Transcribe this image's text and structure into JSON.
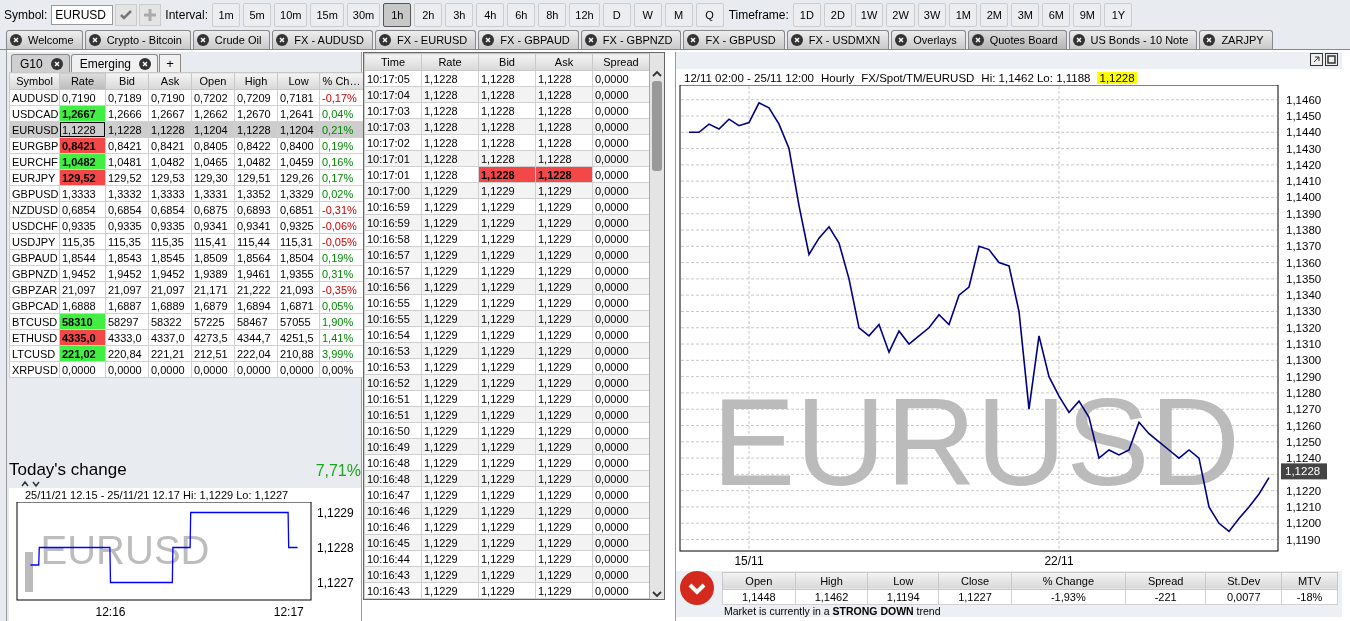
{
  "toolbar": {
    "symbol_label": "Symbol:",
    "symbol": "EURUSD",
    "interval_label": "Interval:",
    "intervals": [
      {
        "label": "1m",
        "selected": false
      },
      {
        "label": "5m",
        "selected": false
      },
      {
        "label": "10m",
        "selected": false
      },
      {
        "label": "15m",
        "selected": false
      },
      {
        "label": "30m",
        "selected": false
      },
      {
        "label": "1h",
        "selected": true
      },
      {
        "label": "2h",
        "selected": false
      },
      {
        "label": "3h",
        "selected": false
      },
      {
        "label": "4h",
        "selected": false
      },
      {
        "label": "6h",
        "selected": false
      },
      {
        "label": "8h",
        "selected": false
      },
      {
        "label": "12h",
        "selected": false
      },
      {
        "label": "D",
        "selected": false
      },
      {
        "label": "W",
        "selected": false
      },
      {
        "label": "M",
        "selected": false
      },
      {
        "label": "Q",
        "selected": false
      }
    ],
    "timeframe_label": "Timeframe:",
    "timeframes": [
      {
        "label": "1D",
        "selected": false
      },
      {
        "label": "2D",
        "selected": false
      },
      {
        "label": "1W",
        "selected": false
      },
      {
        "label": "2W",
        "selected": false
      },
      {
        "label": "3W",
        "selected": false
      },
      {
        "label": "1M",
        "selected": false
      },
      {
        "label": "2M",
        "selected": false
      },
      {
        "label": "3M",
        "selected": false
      },
      {
        "label": "6M",
        "selected": false
      },
      {
        "label": "9M",
        "selected": false
      },
      {
        "label": "1Y",
        "selected": false
      }
    ]
  },
  "tabs": [
    {
      "label": "Welcome",
      "selected": false
    },
    {
      "label": "Crypto - Bitcoin",
      "selected": false
    },
    {
      "label": "Crude Oil",
      "selected": false
    },
    {
      "label": "FX - AUDUSD",
      "selected": false
    },
    {
      "label": "FX - EURUSD",
      "selected": false
    },
    {
      "label": "FX - GBPAUD",
      "selected": false
    },
    {
      "label": "FX - GBPNZD",
      "selected": false
    },
    {
      "label": "FX - GBPUSD",
      "selected": false
    },
    {
      "label": "FX - USDMXN",
      "selected": false
    },
    {
      "label": "Overlays",
      "selected": false
    },
    {
      "label": "Quotes Board",
      "selected": true
    },
    {
      "label": "US Bonds - 10 Note",
      "selected": false
    },
    {
      "label": "ZARJPY",
      "selected": false
    }
  ],
  "quote_board": {
    "tabs": [
      {
        "label": "G10",
        "selected": true
      },
      {
        "label": "Emerging",
        "selected": false
      }
    ],
    "add_tab": "+",
    "columns": [
      "Symbol",
      "Rate",
      "Bid",
      "Ask",
      "Open",
      "High",
      "Low",
      "% Ch…"
    ],
    "rows": [
      {
        "symbol": "AUDUSD",
        "rate": {
          "text": "0,7190"
        },
        "bid": "0,7189",
        "ask": "0,7190",
        "open": "0,7202",
        "high": "0,7209",
        "low": "0,7181",
        "change": {
          "text": "-0,17%",
          "negative": true,
          "positive": false
        },
        "selected": false
      },
      {
        "symbol": "USDCAD",
        "rate": {
          "text": "1,2667",
          "color": "#41ee41"
        },
        "bid": "1,2666",
        "ask": "1,2667",
        "open": "1,2662",
        "high": "1,2670",
        "low": "1,2641",
        "change": {
          "text": "0,04%",
          "negative": false,
          "positive": true
        },
        "selected": false
      },
      {
        "symbol": "EURUSD",
        "rate": {
          "text": "1,1228"
        },
        "bid": "1,1228",
        "ask": "1,1228",
        "open": "1,1204",
        "high": "1,1228",
        "low": "1,1204",
        "change": {
          "text": "0,21%",
          "negative": false,
          "positive": true
        },
        "selected": true
      },
      {
        "symbol": "EURGBP",
        "rate": {
          "text": "0,8421",
          "color": "#f44848"
        },
        "bid": "0,8421",
        "ask": "0,8421",
        "open": "0,8405",
        "high": "0,8422",
        "low": "0,8400",
        "change": {
          "text": "0,19%",
          "negative": false,
          "positive": true
        },
        "selected": false
      },
      {
        "symbol": "EURCHF",
        "rate": {
          "text": "1,0482",
          "color": "#41ee41"
        },
        "bid": "1,0481",
        "ask": "1,0482",
        "open": "1,0465",
        "high": "1,0482",
        "low": "1,0459",
        "change": {
          "text": "0,16%",
          "negative": false,
          "positive": true
        },
        "selected": false
      },
      {
        "symbol": "EURJPY",
        "rate": {
          "text": "129,52",
          "color": "#f44848"
        },
        "bid": "129,52",
        "ask": "129,53",
        "open": "129,30",
        "high": "129,51",
        "low": "129,26",
        "change": {
          "text": "0,17%",
          "negative": false,
          "positive": true
        },
        "selected": false
      },
      {
        "symbol": "GBPUSD",
        "rate": {
          "text": "1,3333"
        },
        "bid": "1,3332",
        "ask": "1,3333",
        "open": "1,3331",
        "high": "1,3352",
        "low": "1,3329",
        "change": {
          "text": "0,02%",
          "negative": false,
          "positive": true
        },
        "selected": false
      },
      {
        "symbol": "NZDUSD",
        "rate": {
          "text": "0,6854"
        },
        "bid": "0,6854",
        "ask": "0,6854",
        "open": "0,6875",
        "high": "0,6893",
        "low": "0,6851",
        "change": {
          "text": "-0,31%",
          "negative": true,
          "positive": false
        },
        "selected": false
      },
      {
        "symbol": "USDCHF",
        "rate": {
          "text": "0,9335"
        },
        "bid": "0,9335",
        "ask": "0,9335",
        "open": "0,9341",
        "high": "0,9341",
        "low": "0,9325",
        "change": {
          "text": "-0,06%",
          "negative": true,
          "positive": false
        },
        "selected": false
      },
      {
        "symbol": "USDJPY",
        "rate": {
          "text": "115,35"
        },
        "bid": "115,35",
        "ask": "115,35",
        "open": "115,41",
        "high": "115,44",
        "low": "115,31",
        "change": {
          "text": "-0,05%",
          "negative": true,
          "positive": false
        },
        "selected": false
      },
      {
        "symbol": "GBPAUD",
        "rate": {
          "text": "1,8544"
        },
        "bid": "1,8543",
        "ask": "1,8545",
        "open": "1,8509",
        "high": "1,8564",
        "low": "1,8504",
        "change": {
          "text": "0,19%",
          "negative": false,
          "positive": true
        },
        "selected": false
      },
      {
        "symbol": "GBPNZD",
        "rate": {
          "text": "1,9452"
        },
        "bid": "1,9452",
        "ask": "1,9452",
        "open": "1,9389",
        "high": "1,9461",
        "low": "1,9355",
        "change": {
          "text": "0,31%",
          "negative": false,
          "positive": true
        },
        "selected": false
      },
      {
        "symbol": "GBPZAR",
        "rate": {
          "text": "21,097"
        },
        "bid": "21,097",
        "ask": "21,097",
        "open": "21,171",
        "high": "21,222",
        "low": "21,093",
        "change": {
          "text": "-0,35%",
          "negative": true,
          "positive": false
        },
        "selected": false
      },
      {
        "symbol": "GBPCAD",
        "rate": {
          "text": "1,6888"
        },
        "bid": "1,6887",
        "ask": "1,6889",
        "open": "1,6879",
        "high": "1,6894",
        "low": "1,6871",
        "change": {
          "text": "0,05%",
          "negative": false,
          "positive": true
        },
        "selected": false
      },
      {
        "symbol": "BTCUSD",
        "rate": {
          "text": "58310",
          "color": "#41ee41"
        },
        "bid": "58297",
        "ask": "58322",
        "open": "57225",
        "high": "58467",
        "low": "57055",
        "change": {
          "text": "1,90%",
          "negative": false,
          "positive": true
        },
        "selected": false
      },
      {
        "symbol": "ETHUSD",
        "rate": {
          "text": "4335,0",
          "color": "#f44848"
        },
        "bid": "4333,0",
        "ask": "4337,0",
        "open": "4273,5",
        "high": "4344,7",
        "low": "4251,5",
        "change": {
          "text": "1,41%",
          "negative": false,
          "positive": true
        },
        "selected": false
      },
      {
        "symbol": "LTCUSD",
        "rate": {
          "text": "221,02",
          "color": "#41ee41"
        },
        "bid": "220,84",
        "ask": "221,21",
        "open": "212,51",
        "high": "222,04",
        "low": "210,88",
        "change": {
          "text": "3,99%",
          "negative": false,
          "positive": true
        },
        "selected": false
      },
      {
        "symbol": "XRPUSD",
        "rate": {
          "text": "0,0000"
        },
        "bid": "0,0000",
        "ask": "0,0000",
        "open": "0,0000",
        "high": "0,0000",
        "low": "0,0000",
        "change": {
          "text": "0,00%",
          "negative": false,
          "positive": false
        },
        "selected": false
      }
    ]
  },
  "todays_change": {
    "label": "Today's change",
    "value": "7,71%"
  },
  "mini_chart": {
    "caption": "25/11/21 12.15 - 25/11/21 12.17 Hi: 1,1229 Lo: 1,1227",
    "watermark": "EURUSD",
    "y_labels": [
      "1,1229",
      "1,1228",
      "1,1227"
    ],
    "x_labels": [
      "12:16",
      "12:17"
    ]
  },
  "ticks": {
    "columns": [
      "Time",
      "Rate",
      "Bid",
      "Ask",
      "Spread"
    ],
    "rows": [
      {
        "cells": [
          "10:17:05",
          "1,1228",
          "1,1228",
          "1,1228",
          "0,0000"
        ]
      },
      {
        "cells": [
          "10:17:04",
          "1,1228",
          "1,1228",
          "1,1228",
          "0,0000"
        ]
      },
      {
        "cells": [
          "10:17:03",
          "1,1228",
          "1,1228",
          "1,1228",
          "0,0000"
        ]
      },
      {
        "cells": [
          "10:17:03",
          "1,1228",
          "1,1228",
          "1,1228",
          "0,0000"
        ]
      },
      {
        "cells": [
          "10:17:02",
          "1,1228",
          "1,1228",
          "1,1228",
          "0,0000"
        ]
      },
      {
        "cells": [
          "10:17:01",
          "1,1228",
          "1,1228",
          "1,1228",
          "0,0000"
        ]
      },
      {
        "cells": [
          "10:17:01",
          "1,1228",
          "1,1228",
          "1,1228",
          "0,0000"
        ],
        "color": "#f44848"
      },
      {
        "cells": [
          "10:17:00",
          "1,1229",
          "1,1229",
          "1,1229",
          "0,0000"
        ]
      },
      {
        "cells": [
          "10:16:59",
          "1,1229",
          "1,1229",
          "1,1229",
          "0,0000"
        ]
      },
      {
        "cells": [
          "10:16:59",
          "1,1229",
          "1,1229",
          "1,1229",
          "0,0000"
        ]
      },
      {
        "cells": [
          "10:16:58",
          "1,1229",
          "1,1229",
          "1,1229",
          "0,0000"
        ]
      },
      {
        "cells": [
          "10:16:57",
          "1,1229",
          "1,1229",
          "1,1229",
          "0,0000"
        ]
      },
      {
        "cells": [
          "10:16:57",
          "1,1229",
          "1,1229",
          "1,1229",
          "0,0000"
        ]
      },
      {
        "cells": [
          "10:16:56",
          "1,1229",
          "1,1229",
          "1,1229",
          "0,0000"
        ]
      },
      {
        "cells": [
          "10:16:55",
          "1,1229",
          "1,1229",
          "1,1229",
          "0,0000"
        ]
      },
      {
        "cells": [
          "10:16:55",
          "1,1229",
          "1,1229",
          "1,1229",
          "0,0000"
        ]
      },
      {
        "cells": [
          "10:16:54",
          "1,1229",
          "1,1229",
          "1,1229",
          "0,0000"
        ]
      },
      {
        "cells": [
          "10:16:53",
          "1,1229",
          "1,1229",
          "1,1229",
          "0,0000"
        ]
      },
      {
        "cells": [
          "10:16:53",
          "1,1229",
          "1,1229",
          "1,1229",
          "0,0000"
        ]
      },
      {
        "cells": [
          "10:16:52",
          "1,1229",
          "1,1229",
          "1,1229",
          "0,0000"
        ]
      },
      {
        "cells": [
          "10:16:51",
          "1,1229",
          "1,1229",
          "1,1229",
          "0,0000"
        ]
      },
      {
        "cells": [
          "10:16:51",
          "1,1229",
          "1,1229",
          "1,1229",
          "0,0000"
        ]
      },
      {
        "cells": [
          "10:16:50",
          "1,1229",
          "1,1229",
          "1,1229",
          "0,0000"
        ]
      },
      {
        "cells": [
          "10:16:49",
          "1,1229",
          "1,1229",
          "1,1229",
          "0,0000"
        ]
      },
      {
        "cells": [
          "10:16:48",
          "1,1229",
          "1,1229",
          "1,1229",
          "0,0000"
        ]
      },
      {
        "cells": [
          "10:16:48",
          "1,1229",
          "1,1229",
          "1,1229",
          "0,0000"
        ]
      },
      {
        "cells": [
          "10:16:47",
          "1,1229",
          "1,1229",
          "1,1229",
          "0,0000"
        ]
      },
      {
        "cells": [
          "10:16:46",
          "1,1229",
          "1,1229",
          "1,1229",
          "0,0000"
        ]
      },
      {
        "cells": [
          "10:16:46",
          "1,1229",
          "1,1229",
          "1,1229",
          "0,0000"
        ]
      },
      {
        "cells": [
          "10:16:45",
          "1,1229",
          "1,1229",
          "1,1229",
          "0,0000"
        ]
      },
      {
        "cells": [
          "10:16:44",
          "1,1229",
          "1,1229",
          "1,1229",
          "0,0000"
        ]
      },
      {
        "cells": [
          "10:16:43",
          "1,1229",
          "1,1229",
          "1,1229",
          "0,0000"
        ]
      },
      {
        "cells": [
          "10:16:43",
          "1,1229",
          "1,1229",
          "1,1229",
          "0,0000"
        ]
      }
    ]
  },
  "main_chart": {
    "range": "12/11 02:00 - 25/11 12:00",
    "interval": "Hourly",
    "instrument": "FX/Spot/TM/EURUSD",
    "hilo": "Hi: 1,1462 Lo: 1,1188",
    "last": "1,1228",
    "watermark": "EURUSD",
    "y_labels_above_tag": [
      "1,1460",
      "1,1450",
      "1,1440",
      "1,1430",
      "1,1420",
      "1,1410",
      "1,1400",
      "1,1390",
      "1,1380",
      "1,1370",
      "1,1360",
      "1,1350",
      "1,1340",
      "1,1330",
      "1,1320",
      "1,1310",
      "1,1300",
      "1,1290",
      "1,1280",
      "1,1270",
      "1,1260",
      "1,1250",
      "1,1240"
    ],
    "price_tag": "1,1228",
    "y_labels_below_tag": [
      "1,1220",
      "1,1210",
      "1,1200",
      "1,1190"
    ],
    "x_labels": [
      "15/11",
      "22/11"
    ]
  },
  "stats": {
    "columns": [
      "Open",
      "High",
      "Low",
      "Close",
      "% Change",
      "Spread",
      "St.Dev",
      "MTV"
    ],
    "values": [
      "1,1448",
      "1,1462",
      "1,1194",
      "1,1227",
      "-1,93%",
      "-221",
      "0,0077",
      "-18%"
    ]
  },
  "trend_message": "Market is currently in a **STRONG DOWN** trend"
}
